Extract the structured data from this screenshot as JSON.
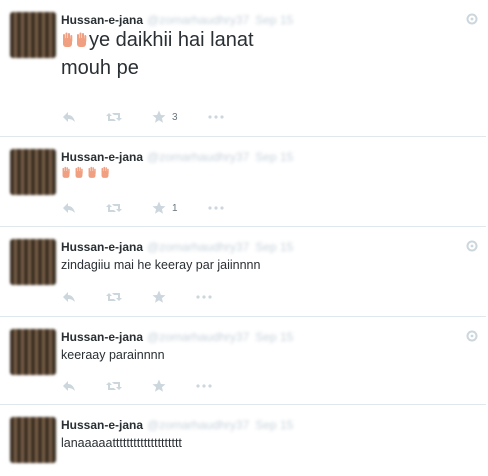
{
  "tweets": [
    {
      "name": "Hussan-e-jana",
      "text": "ye daikhii hai lanat",
      "text2": "mouh pe",
      "likes": "3",
      "emoji_count": 2,
      "gear": true
    },
    {
      "name": "Hussan-e-jana",
      "text": "",
      "likes": "1",
      "emoji_count": 4,
      "gear": false
    },
    {
      "name": "Hussan-e-jana",
      "text": "zindagiiu mai he keeray par jaiinnnn",
      "likes": "",
      "gear": true
    },
    {
      "name": "Hussan-e-jana",
      "text": "keeraay parainnnn",
      "likes": "",
      "gear": true
    },
    {
      "name": "Hussan-e-jana",
      "text": "lanaaaaatttttttttttttttttttt",
      "likes": "",
      "gear": false
    }
  ],
  "icons": {
    "reply": "reply-icon",
    "retweet": "retweet-icon",
    "favorite": "star-icon",
    "more": "more-icon",
    "gear": "gear-icon",
    "emoji": "raised-hand-emoji"
  },
  "colors": {
    "icon": "#ccd6dd",
    "border": "#e1e8ed",
    "text": "#292f33",
    "hand": "#f0a080"
  }
}
